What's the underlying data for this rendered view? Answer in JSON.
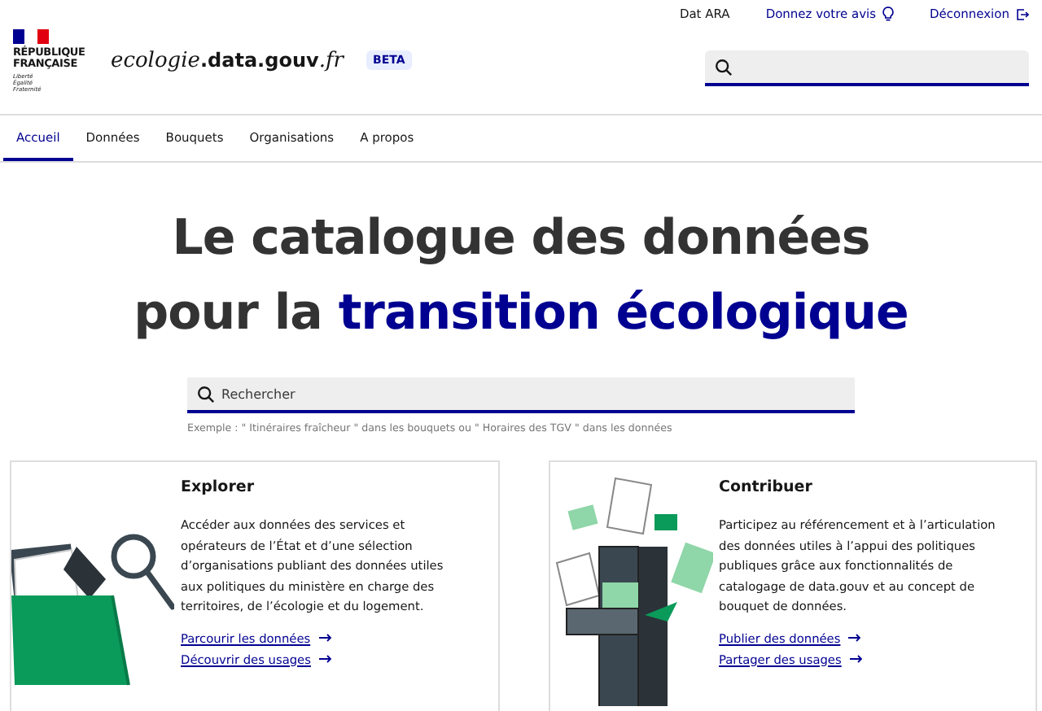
{
  "header": {
    "logo": {
      "line1": "RÉPUBLIQUE",
      "line2": "FRANÇAISE",
      "motto": [
        "Liberté",
        "Égalité",
        "Fraternité"
      ]
    },
    "site_name": {
      "prefix": "ecologie",
      "middle": ".data.gouv",
      "suffix": ".fr"
    },
    "badge": "BETA",
    "links": [
      {
        "label": "Dat ARA",
        "kind": "text"
      },
      {
        "label": "Donnez votre avis",
        "kind": "feedback"
      },
      {
        "label": "Déconnexion",
        "kind": "logout"
      }
    ]
  },
  "nav": [
    {
      "label": "Accueil",
      "selected": true
    },
    {
      "label": "Données",
      "selected": false
    },
    {
      "label": "Bouquets",
      "selected": false
    },
    {
      "label": "Organisations",
      "selected": false
    },
    {
      "label": "A propos",
      "selected": false
    }
  ],
  "hero": {
    "title_lines": [
      "Le catalogue des données",
      "pour la **transition écologique**"
    ],
    "search_placeholder": "Rechercher",
    "hint": "Exemple : \" Itinéraires fraîcheur \" dans les bouquets ou \" Horaires des TGV \" dans les données"
  },
  "cards": [
    {
      "kind": "explore",
      "title": "Explorer",
      "text": "Accéder aux données des services et opérateurs de l’État et d’une sélection d’organisations publiant des données utiles aux politiques du ministère en charge des territoires, de l’écologie et du logement.",
      "links": [
        "Parcourir les données",
        "Découvrir des usages"
      ]
    },
    {
      "kind": "contribute",
      "title": "Contribuer",
      "text": "Participez au référencement et à l’articulation des données utiles à l’appui des politiques publiques grâce aux fonctionnalités de catalogage de data.gouv et au concept de bouquet de données.",
      "links": [
        "Publier des données",
        "Partager des usages"
      ]
    }
  ]
}
